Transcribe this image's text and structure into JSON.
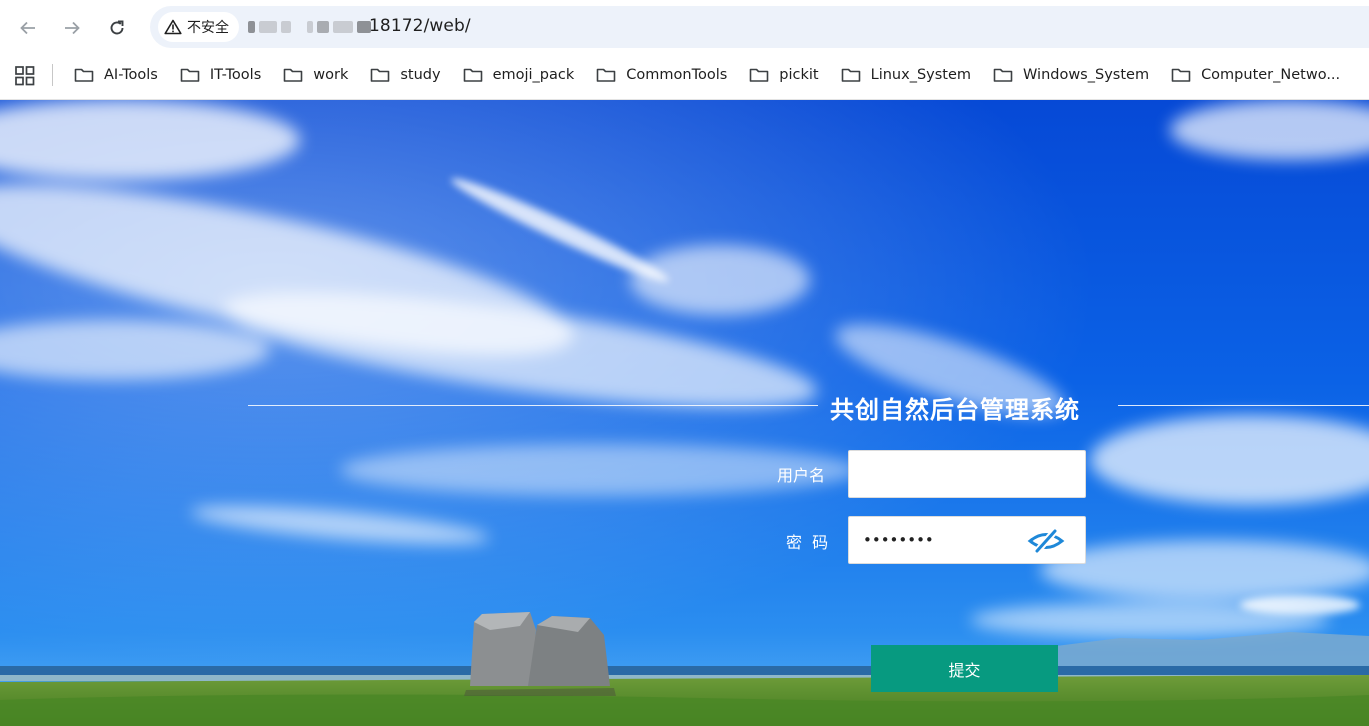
{
  "browser": {
    "security_label": "不安全",
    "url_visible": "18172/web/",
    "bookmarks": [
      {
        "label": "AI-Tools"
      },
      {
        "label": "IT-Tools"
      },
      {
        "label": "work"
      },
      {
        "label": "study"
      },
      {
        "label": "emoji_pack"
      },
      {
        "label": "CommonTools"
      },
      {
        "label": "pickit"
      },
      {
        "label": "Linux_System"
      },
      {
        "label": "Windows_System"
      },
      {
        "label": "Computer_Netwo..."
      }
    ]
  },
  "login": {
    "title": "共创自然后台管理系统",
    "username_label": "用户名",
    "username_value": "",
    "password_label": "密  码",
    "password_value": "••••••••",
    "submit_label": "提交"
  },
  "colors": {
    "submit_bg": "#079a80",
    "eye_icon": "#1e88d8",
    "sky": "#0a5fe0"
  }
}
